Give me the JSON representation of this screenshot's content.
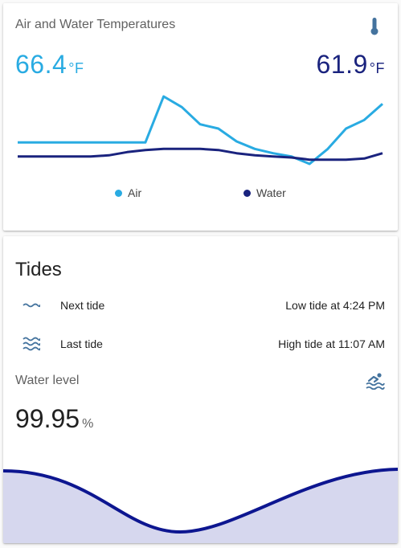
{
  "temps_card": {
    "title": "Air and Water Temperatures",
    "icon": "thermometer-icon",
    "air": {
      "value": "66.4",
      "unit": "°F",
      "color": "#29abe2"
    },
    "water": {
      "value": "61.9",
      "unit": "°F",
      "color": "#1a237e"
    },
    "legend": [
      {
        "label": "Air",
        "color": "#29abe2"
      },
      {
        "label": "Water",
        "color": "#1a237e"
      }
    ]
  },
  "chart_data": {
    "type": "line",
    "title": "",
    "xlabel": "",
    "ylabel": "",
    "grid": false,
    "legend_position": "bottom",
    "x": [
      0,
      5,
      10,
      15,
      20,
      25,
      30,
      35,
      40,
      45,
      50,
      55,
      60,
      65,
      70,
      75,
      80,
      85,
      90,
      95,
      100
    ],
    "series": [
      {
        "name": "Air",
        "color": "#29abe2",
        "values": [
          63.5,
          63.5,
          63.5,
          63.5,
          63.5,
          63.5,
          63.5,
          63.5,
          67.8,
          66.8,
          65.2,
          64.8,
          63.6,
          62.9,
          62.5,
          62.2,
          61.5,
          62.9,
          64.8,
          65.6,
          67.1
        ]
      },
      {
        "name": "Water",
        "color": "#1a237e",
        "values": [
          62.2,
          62.2,
          62.2,
          62.2,
          62.2,
          62.3,
          62.6,
          62.8,
          62.9,
          62.9,
          62.9,
          62.8,
          62.5,
          62.3,
          62.2,
          62.1,
          61.9,
          61.9,
          61.9,
          62.0,
          62.5
        ]
      }
    ]
  },
  "tides_card": {
    "title": "Tides",
    "rows": [
      {
        "icon": "wave-icon",
        "label": "Next tide",
        "value": "Low tide at 4:24 PM"
      },
      {
        "icon": "waves-icon",
        "label": "Last tide",
        "value": "High tide at 11:07 AM"
      }
    ],
    "water_level": {
      "label": "Water level",
      "icon": "swimmer-icon",
      "value": "99.95",
      "unit": "%",
      "line_color": "#0d1690",
      "fill_color": "#d6d7ee"
    }
  }
}
